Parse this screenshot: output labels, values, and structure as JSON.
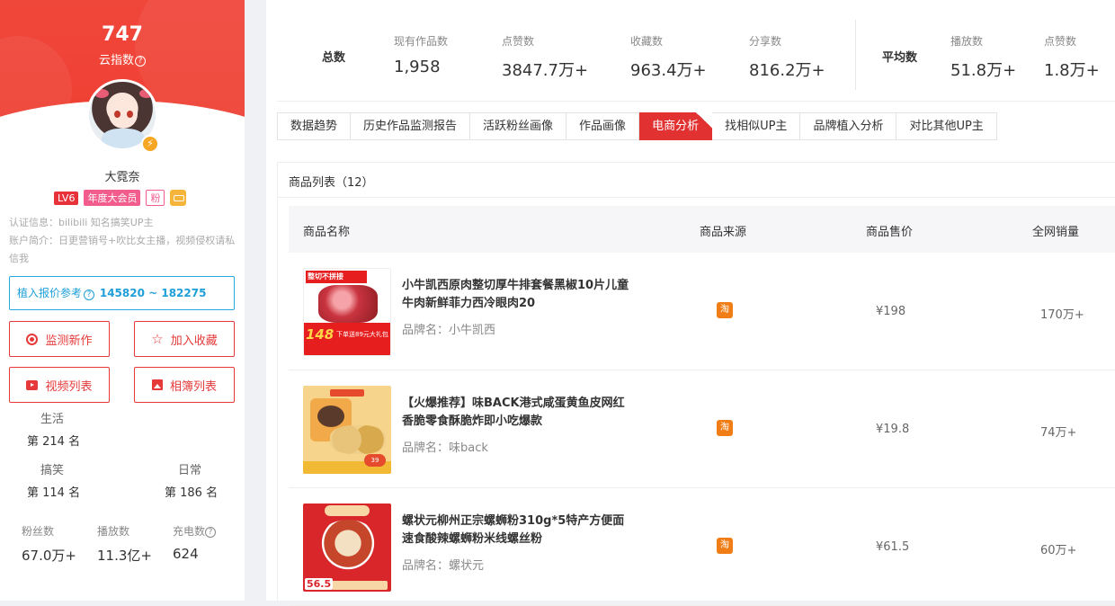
{
  "profile": {
    "score": "747",
    "score_label": "云指数",
    "username": "大霓奈",
    "level": "LV6",
    "vip": "年度大会员",
    "fan_tag": "粉",
    "cert_info": "认证信息：bilibili 知名搞笑UP主",
    "bio": "账户简介：日更营销号+吹比女主播，视频侵权请私信我",
    "quote_label": "植入报价参考",
    "quote_range": "145820 ~ 182275",
    "buttons": {
      "monitor": "监测新作",
      "favorite": "加入收藏",
      "videos": "视频列表",
      "albums": "相簿列表"
    },
    "ranks": [
      {
        "label": "生活",
        "value": "第 214 名"
      },
      {
        "label": "搞笑",
        "value": "第 114 名"
      },
      {
        "label": "日常",
        "value": "第 186 名"
      }
    ],
    "stats": [
      {
        "label": "粉丝数",
        "value": "67.0万+"
      },
      {
        "label": "播放数",
        "value": "11.3亿+"
      },
      {
        "label": "充电数",
        "value": "624"
      }
    ]
  },
  "summary": {
    "total_label": "总数",
    "average_label": "平均数",
    "totals": [
      {
        "label": "现有作品数",
        "value": "1,958"
      },
      {
        "label": "点赞数",
        "value": "3847.7万+"
      },
      {
        "label": "收藏数",
        "value": "963.4万+"
      },
      {
        "label": "分享数",
        "value": "816.2万+"
      }
    ],
    "averages": [
      {
        "label": "播放数",
        "value": "51.8万+"
      },
      {
        "label": "点赞数",
        "value": "1.8万+"
      }
    ]
  },
  "tabs": [
    "数据趋势",
    "历史作品监测报告",
    "活跃粉丝画像",
    "作品画像",
    "电商分析",
    "找相似UP主",
    "品牌植入分析",
    "对比其他UP主"
  ],
  "active_tab": "电商分析",
  "products": {
    "title": "商品列表（12）",
    "columns": [
      "商品名称",
      "商品来源",
      "商品售价",
      "全网销量"
    ],
    "source_icon_label": "淘",
    "brand_prefix": "品牌名：",
    "rows": [
      {
        "name": "小牛凯西原肉整切厚牛排套餐黑椒10片儿童牛肉新鲜菲力西冷眼肉20",
        "brand": "品牌名：小牛凯西",
        "price": "¥198",
        "sales": "170万+",
        "thumb_head": "整切不拼接",
        "thumb_price": "148",
        "thumb_text": "下单送89元大礼包"
      },
      {
        "name": "【火爆推荐】味BACK港式咸蛋黄鱼皮网红香脆零食酥脆炸即小吃爆款",
        "brand": "品牌名：味back",
        "price": "¥19.8",
        "sales": "74万+",
        "thumb_badge": "39"
      },
      {
        "name": "螺状元柳州正宗螺蛳粉310g*5特产方便面速食酸辣螺蛳粉米线螺丝粉",
        "brand": "品牌名：螺状元",
        "price": "¥61.5",
        "sales": "60万+",
        "thumb_price": "56.5"
      }
    ]
  },
  "colors": {
    "brand_red": "#e23131",
    "link_blue": "#1e9fd9",
    "taobao_orange": "#f07d16"
  }
}
